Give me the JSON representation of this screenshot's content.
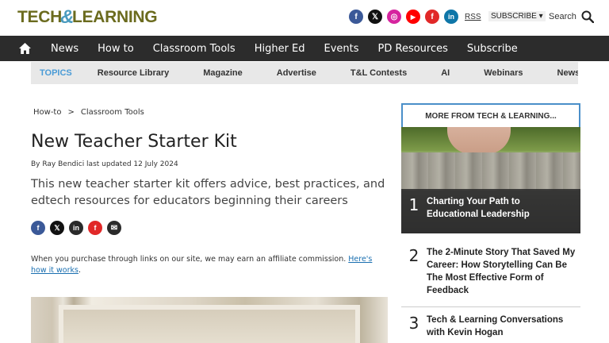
{
  "header": {
    "logo_part1": "TECH",
    "logo_amp": "&",
    "logo_part2": "LEARNING",
    "socials": [
      {
        "icon": "facebook-icon",
        "glyph": "f",
        "color": "#3b5998"
      },
      {
        "icon": "x-icon",
        "glyph": "𝕏",
        "color": "#111111"
      },
      {
        "icon": "instagram-icon",
        "glyph": "◎",
        "color": "#d6249f"
      },
      {
        "icon": "youtube-icon",
        "glyph": "▶",
        "color": "#ff0000"
      },
      {
        "icon": "flipboard-icon",
        "glyph": "f",
        "color": "#e12828"
      },
      {
        "icon": "linkedin-icon",
        "glyph": "in",
        "color": "#0e76a8"
      }
    ],
    "rss_label": "RSS",
    "subscribe_label": "SUBSCRIBE ▾",
    "search_label": "Search"
  },
  "nav": {
    "items": [
      "News",
      "How to",
      "Classroom Tools",
      "Higher Ed",
      "Events",
      "PD Resources",
      "Subscribe"
    ]
  },
  "topics": {
    "label": "TOPICS",
    "items": [
      "Resource Library",
      "Magazine",
      "Advertise",
      "T&L Contests",
      "AI",
      "Webinars",
      "News Sig"
    ]
  },
  "article": {
    "breadcrumb": [
      "How-to",
      ">",
      "Classroom Tools"
    ],
    "title": "New Teacher Starter Kit",
    "byline": "By Ray Bendici last updated 12 July 2024",
    "standfirst": "This new teacher starter kit offers advice, best practices, and edtech resources for educators beginning their careers",
    "share_icons": [
      {
        "icon": "facebook-share-icon",
        "glyph": "f",
        "color": "#3b5998"
      },
      {
        "icon": "x-share-icon",
        "glyph": "𝕏",
        "color": "#111111"
      },
      {
        "icon": "linkedin-share-icon",
        "glyph": "in",
        "color": "#2a2a2a"
      },
      {
        "icon": "flipboard-share-icon",
        "glyph": "f",
        "color": "#e12828"
      },
      {
        "icon": "email-share-icon",
        "glyph": "✉",
        "color": "#2a2a2a"
      }
    ],
    "affiliate_text": "When you purchase through links on our site, we may earn an affiliate commission. ",
    "affiliate_link": "Here's how it works",
    "affiliate_end": "."
  },
  "sidebar": {
    "heading": "MORE FROM TECH & LEARNING...",
    "items": [
      {
        "num": "1",
        "title": "Charting Your Path to Educational Leadership"
      },
      {
        "num": "2",
        "title": "The 2-Minute Story That Saved My Career: How Storytelling Can Be The Most Effective Form of Feedback"
      },
      {
        "num": "3",
        "title": "Tech & Learning Conversations with Kevin Hogan"
      }
    ]
  },
  "colors": {
    "nav_bg": "#2c2c2c",
    "topics_bg": "#e8e8e8",
    "topics_label": "#4a9bd6",
    "sidebar_border": "#4a8fc9",
    "logo": "#6b6b1e"
  }
}
